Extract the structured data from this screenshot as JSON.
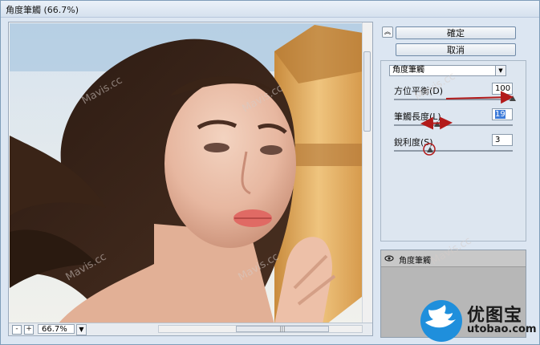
{
  "window": {
    "title": "角度筆觸 (66.7%)"
  },
  "buttons": {
    "ok": "確定",
    "cancel": "取消"
  },
  "filter_select": {
    "value": "角度筆觸"
  },
  "params": [
    {
      "label": "方位平衡(D)",
      "value": "100"
    },
    {
      "label": "筆觸長度(L)",
      "value": "19"
    },
    {
      "label": "銳利度(S)",
      "value": "3"
    }
  ],
  "zoom": {
    "value": "66.7%",
    "minus": "-",
    "plus": "+"
  },
  "layer": {
    "name": "角度筆觸"
  },
  "watermark": {
    "text": "Mavis.cc"
  },
  "brand": {
    "name": "优图宝",
    "url": "utobao.com"
  }
}
